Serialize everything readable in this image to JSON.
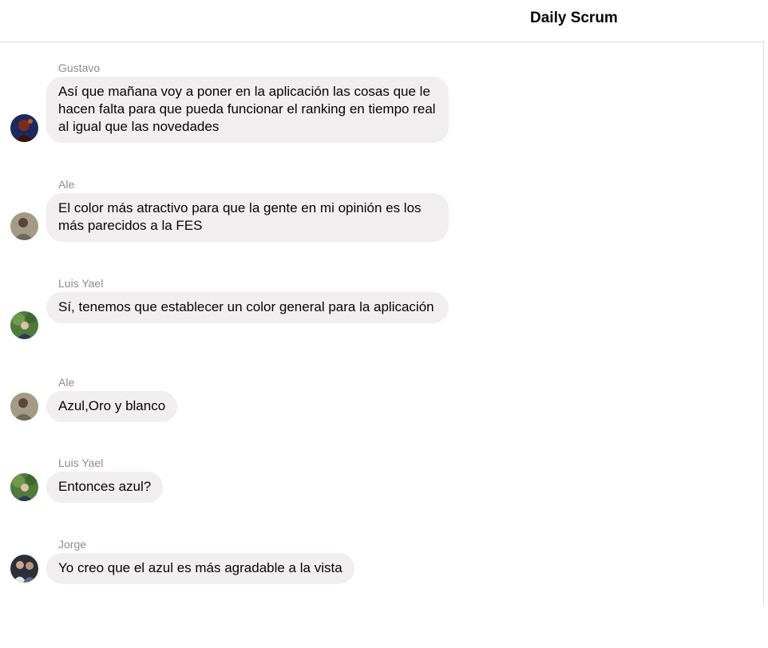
{
  "header": {
    "title": "Daily Scrum"
  },
  "messages": [
    {
      "sender": "Gustavo",
      "text": "Así que mañana voy a poner en la aplicación las cosas que le hacen falta para que pueda funcionar el ranking en tiempo real al igual que las novedades",
      "avatar_icon": "avatar-gustavo-icon"
    },
    {
      "sender": "Ale",
      "text": "El color más atractivo para que la gente en mi opinión es los más parecidos a la FES",
      "avatar_icon": "avatar-ale-icon"
    },
    {
      "sender": "Luis Yael",
      "text": "Sí, tenemos que establecer un color general para la aplicación",
      "avatar_icon": "avatar-luis-yael-icon"
    },
    {
      "sender": "Ale",
      "text": "Azul,Oro y blanco",
      "avatar_icon": "avatar-ale-icon"
    },
    {
      "sender": "Luis Yael",
      "text": "Entonces azul?",
      "avatar_icon": "avatar-luis-yael-icon"
    },
    {
      "sender": "Jorge",
      "text": "Yo creo que el azul es más agradable a la vista",
      "avatar_icon": "avatar-jorge-icon"
    }
  ],
  "colors": {
    "bubble_background": "#f0eeee",
    "sender_name": "#8a8d91",
    "divider": "#dddfe2"
  }
}
